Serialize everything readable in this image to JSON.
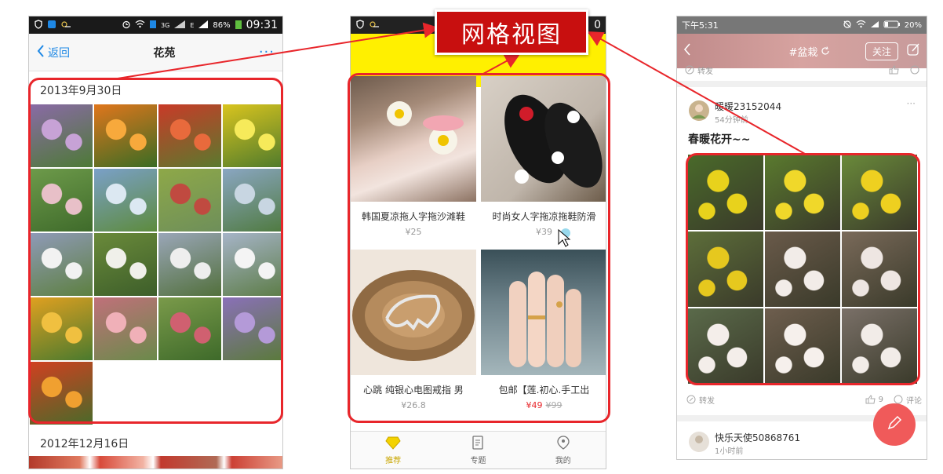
{
  "callout": {
    "label": "网格视图"
  },
  "phone1": {
    "status": {
      "icons": [
        "shield-icon",
        "app-icon",
        "weather-icon",
        "alarm-icon",
        "wifi-icon",
        "sim-icon"
      ],
      "network": "3G",
      "edge": "E",
      "battery": "86%",
      "time": "09:31"
    },
    "nav": {
      "back_label": "返回",
      "title": "花苑",
      "more_label": "···"
    },
    "sections": [
      {
        "date": "2013年9月30日",
        "photo_count": 17
      },
      {
        "date": "2012年12月16日"
      }
    ]
  },
  "phone2": {
    "status": {
      "time_partial": "0"
    },
    "products": [
      {
        "name": "韩国夏凉拖人字拖沙滩鞋",
        "price": "¥25"
      },
      {
        "name": "时尚女人字拖凉拖鞋防滑",
        "price": "¥39"
      },
      {
        "name": "心跳 纯银心电图戒指 男",
        "price": "¥26.8"
      },
      {
        "name": "包邮【莲.初心.手工出",
        "price": "¥49",
        "original_price": "¥99"
      }
    ],
    "tabs": [
      {
        "label": "推荐",
        "icon": "diamond-icon"
      },
      {
        "label": "专题",
        "icon": "document-icon"
      },
      {
        "label": "我的",
        "icon": "profile-icon"
      }
    ]
  },
  "phone3": {
    "status": {
      "time": "下午5:31",
      "battery": "20%"
    },
    "header": {
      "title": "#盆栽",
      "follow_label": "关注"
    },
    "prev_post": {
      "share_label": "转发"
    },
    "post": {
      "username": "暖暖23152044",
      "time": "54分钟前",
      "text": "春暖花开~~",
      "like_count": "9",
      "comment_label": "评论",
      "share_label": "转发"
    },
    "next_post": {
      "username": "快乐天使50868761",
      "time": "1小时前"
    }
  },
  "colors": {
    "accent_red": "#e8262b",
    "ios_blue": "#1e88e5",
    "yellow": "#fff000"
  }
}
